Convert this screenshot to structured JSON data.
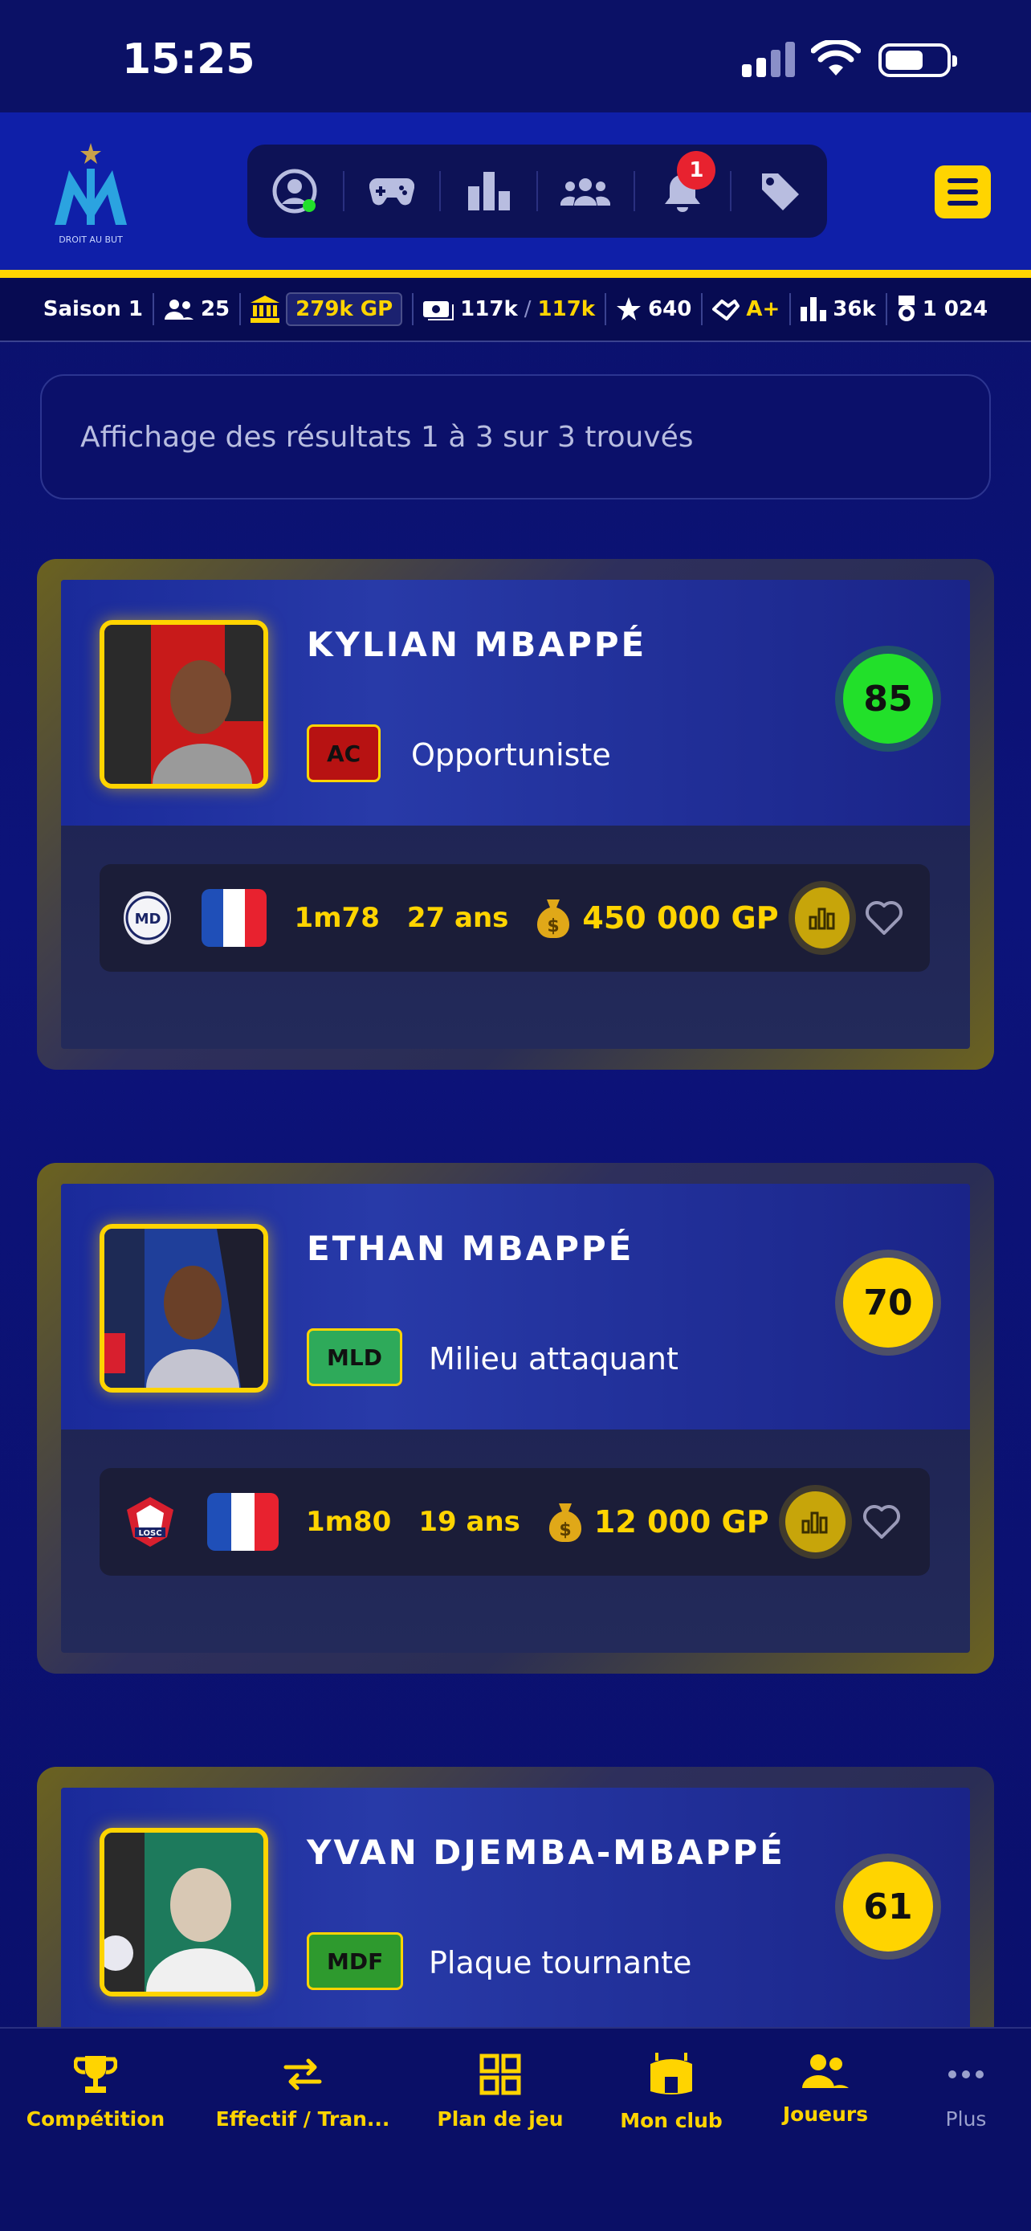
{
  "status_bar": {
    "time": "15:25"
  },
  "header": {
    "club_motto": "DROIT AU BUT",
    "notifications_count": "1"
  },
  "stats_strip": {
    "season": "Saison 1",
    "members": "25",
    "bank": "279k GP",
    "cash": "117k",
    "cash_max": "117k",
    "stars": "640",
    "rank": "A+",
    "points": "36k",
    "trophies": "1 024"
  },
  "results": {
    "text": "Affichage des résultats 1 à 3 sur 3 trouvés"
  },
  "players": [
    {
      "name": "KYLIAN MBAPPÉ",
      "position": "AC",
      "role": "Opportuniste",
      "rating": "85",
      "height": "1m78",
      "age": "27 ans",
      "price": "450 000 GP",
      "rating_color": "#22e02a",
      "position_color": "#b71212"
    },
    {
      "name": "ETHAN MBAPPÉ",
      "position": "MLD",
      "role": "Milieu attaquant",
      "rating": "70",
      "height": "1m80",
      "age": "19 ans",
      "price": "12 000 GP",
      "rating_color": "#ffd400",
      "position_color": "#2eaa5a"
    },
    {
      "name": "YVAN DJEMBA-MBAPPÉ",
      "position": "MDF",
      "role": "Plaque tournante",
      "rating": "61",
      "rating_color": "#ffd400",
      "position_color": "#2e9a2e"
    }
  ],
  "tabbar": {
    "competition": "Compétition",
    "effectif": "Effectif / Tran...",
    "plan": "Plan de jeu",
    "monclub": "Mon club",
    "joueurs": "Joueurs",
    "plus": "Plus"
  }
}
